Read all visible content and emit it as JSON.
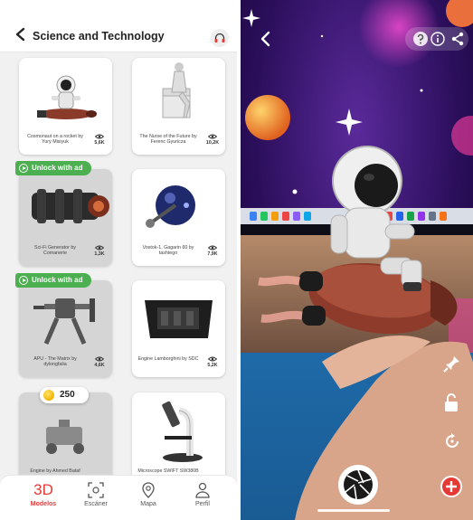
{
  "header": {
    "title": "Science and Technology"
  },
  "cards": [
    {
      "caption": "Cosmonaut on a rocket by Yury Misiyuk",
      "views": "5,6K",
      "locked": false
    },
    {
      "caption": "The Nurse of the Future by Ferenc Gyuricza",
      "views": "10,2K",
      "locked": false
    },
    {
      "caption": "Sci-Fi Generator by Comanerie",
      "views": "1,3K",
      "locked": true
    },
    {
      "caption": "Vostok-1, Gagarin 60 by tashtego",
      "views": "7,9K",
      "locked": false
    },
    {
      "caption": "APU - The Matrix by dylongfalia",
      "views": "4,6K",
      "locked": true
    },
    {
      "caption": "Engine Lamborghini by SDC",
      "views": "5,2K",
      "locked": false
    },
    {
      "caption": "Engine by Ahmed Bataf",
      "views": "",
      "locked": true
    },
    {
      "caption": "Microscope SWIFT SW380B",
      "views": "",
      "locked": false
    }
  ],
  "badges": {
    "unlock_label": "Unlock with ad",
    "coin_cost": "250"
  },
  "nav": {
    "models": "Modelos",
    "models_glyph": "3D",
    "scanner": "Escáner",
    "map": "Mapa",
    "profile": "Perfil"
  },
  "colors": {
    "accent": "#e53935",
    "unlock_green": "#4caf50",
    "coin": "#f5b400"
  },
  "icons": [
    "back-chevron-icon",
    "headphones-icon",
    "eye-icon",
    "play-circle-icon",
    "coin-icon",
    "scan-icon",
    "map-pin-icon",
    "person-icon",
    "info-icon",
    "share-icon",
    "pin-icon",
    "lock-icon",
    "rotate-icon",
    "add-icon",
    "shutter-icon"
  ]
}
